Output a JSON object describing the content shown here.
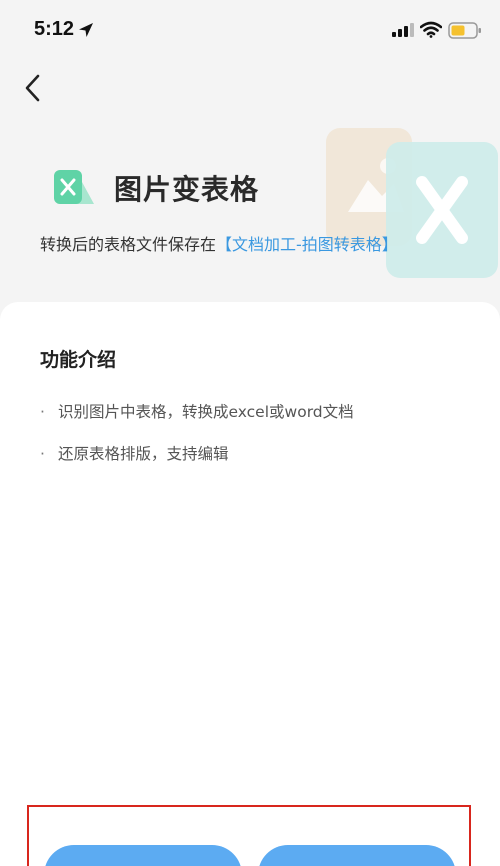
{
  "status_bar": {
    "time": "5:12"
  },
  "header": {
    "back_icon": "chevron-left-icon"
  },
  "hero": {
    "icon": "excel-image-icon",
    "title": "图片变表格",
    "save_prefix": "转换后的表格文件保存在",
    "save_link": "【文档加工-拍图转表格】"
  },
  "features": {
    "title": "功能介绍",
    "items": [
      "识别图片中表格，转换成excel或word文档",
      "还原表格排版，支持编辑"
    ]
  },
  "colors": {
    "accent": "#3a98e0",
    "button": "#5cabf2",
    "highlight_border": "#d8261d"
  }
}
